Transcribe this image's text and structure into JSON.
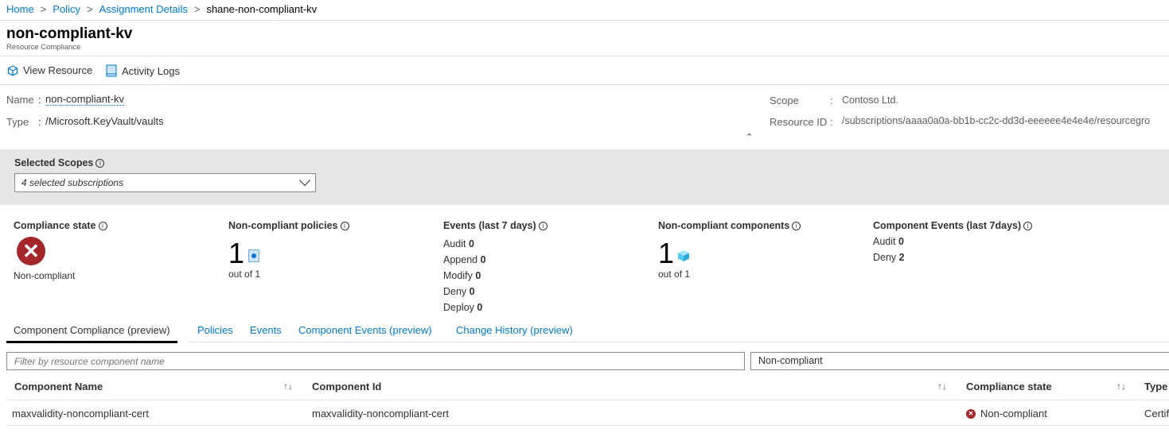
{
  "breadcrumb": [
    "Home",
    "Policy",
    "Assignment Details",
    "shane-non-compliant-kv"
  ],
  "header": {
    "title": "non-compliant-kv",
    "subtitle": "Resource Compliance"
  },
  "toolbar": {
    "view_resource": "View Resource",
    "activity_logs": "Activity Logs"
  },
  "details": {
    "name_label": "Name",
    "name_value": "non-compliant-kv",
    "type_label": "Type",
    "type_value": "/Microsoft.KeyVault/vaults",
    "scope_label": "Scope",
    "scope_value": "Contoso Ltd.",
    "resource_id_label": "Resource ID",
    "resource_id_value": "/subscriptions/aaaa0a0a-bb1b-cc2c-dd3d-eeeeee4e4e4e/resourcegro"
  },
  "scopes": {
    "label": "Selected Scopes",
    "value": "4 selected subscriptions"
  },
  "summary": {
    "compliance_state": {
      "label": "Compliance state",
      "value": "Non-compliant"
    },
    "policies": {
      "label": "Non-compliant policies",
      "count": "1",
      "out_of": "out of 1"
    },
    "events": {
      "label": "Events (last 7 days)",
      "items": [
        {
          "k": "Audit",
          "v": "0"
        },
        {
          "k": "Append",
          "v": "0"
        },
        {
          "k": "Modify",
          "v": "0"
        },
        {
          "k": "Deny",
          "v": "0"
        },
        {
          "k": "Deploy",
          "v": "0"
        }
      ]
    },
    "components": {
      "label": "Non-compliant components",
      "count": "1",
      "out_of": "out of 1"
    },
    "component_events": {
      "label": "Component Events (last 7days)",
      "items": [
        {
          "k": "Audit",
          "v": "0"
        },
        {
          "k": "Deny",
          "v": "2"
        }
      ]
    }
  },
  "tabs": [
    "Component Compliance (preview)",
    "Policies",
    "Events",
    "Component Events (preview)",
    "Change History (preview)"
  ],
  "filter": {
    "placeholder": "Filter by resource component name",
    "state_value": "Non-compliant"
  },
  "table": {
    "columns": [
      "Component Name",
      "Component Id",
      "Compliance state",
      "Type"
    ],
    "rows": [
      {
        "name": "maxvalidity-noncompliant-cert",
        "id": "maxvalidity-noncompliant-cert",
        "state": "Non-compliant",
        "type": "Certif"
      }
    ]
  },
  "colors": {
    "accent": "#0078d4",
    "error": "#a4262c"
  }
}
